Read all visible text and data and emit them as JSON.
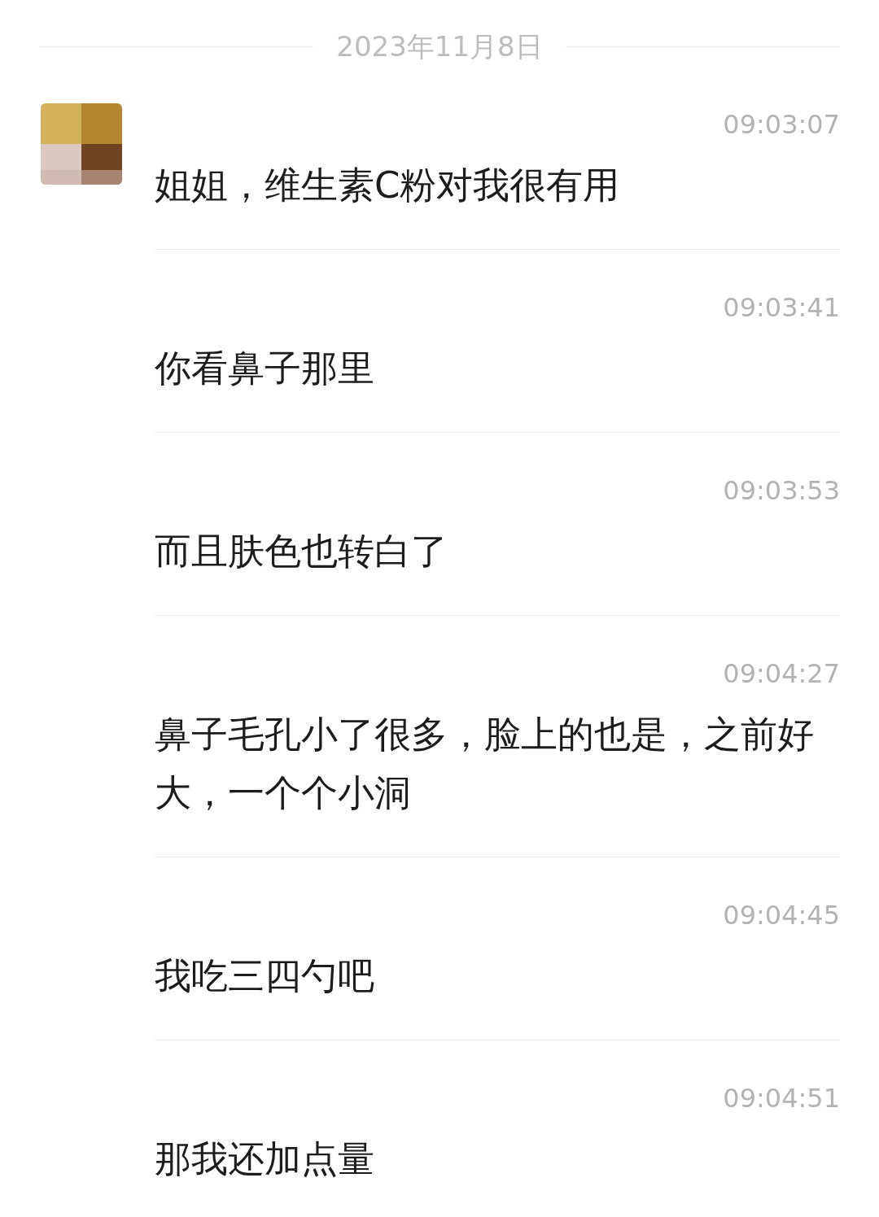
{
  "date": "2023年11月8日",
  "messages": [
    {
      "time": "09:03:07",
      "text": "姐姐，维生素C粉对我很有用"
    },
    {
      "time": "09:03:41",
      "text": "你看鼻子那里"
    },
    {
      "time": "09:03:53",
      "text": "而且肤色也转白了"
    },
    {
      "time": "09:04:27",
      "text": "鼻子毛孔小了很多，脸上的也是，之前好大，一个个小洞"
    },
    {
      "time": "09:04:45",
      "text": "我吃三四勺吧"
    },
    {
      "time": "09:04:51",
      "text": "那我还加点量"
    }
  ]
}
